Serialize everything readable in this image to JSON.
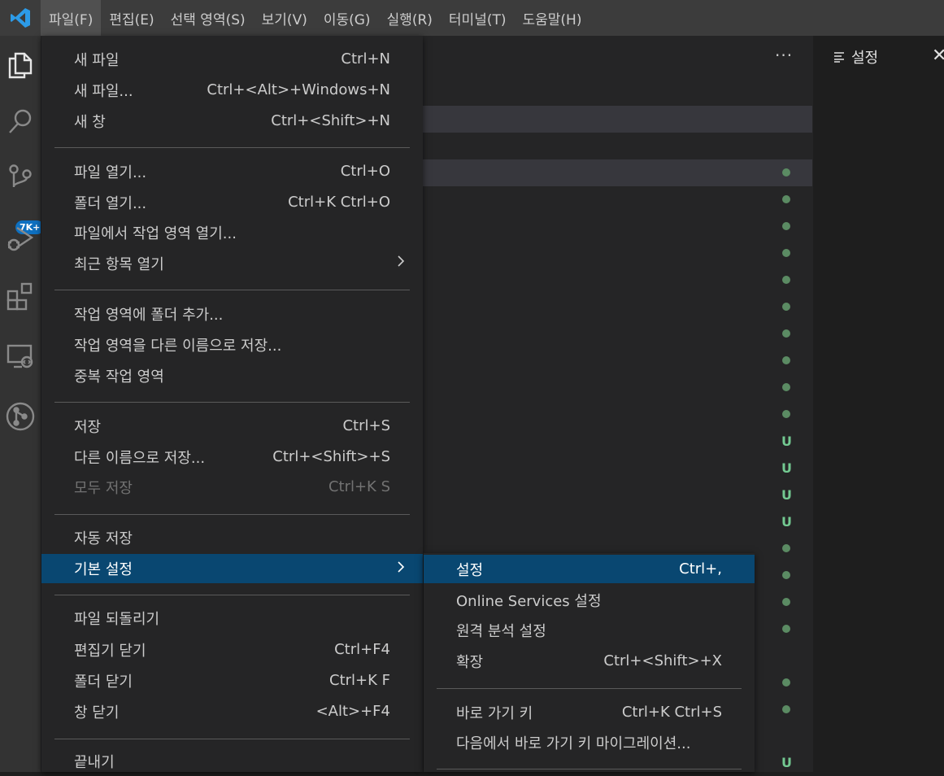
{
  "menubar": {
    "items": [
      "파일(F)",
      "편집(E)",
      "선택 영역(S)",
      "보기(V)",
      "이동(G)",
      "실행(R)",
      "터미널(T)",
      "도움말(H)"
    ]
  },
  "activity": {
    "badge": "7K+"
  },
  "editor": {
    "more_label": "···"
  },
  "right_panel": {
    "title": "설정",
    "close": "✕"
  },
  "status_markers": [
    "•",
    "•",
    "•",
    "•",
    "•",
    "•",
    "•",
    "•",
    "•",
    "•",
    "U",
    "U",
    "U",
    "U",
    "•",
    "•",
    "•",
    "•",
    "•",
    "•",
    "U"
  ],
  "file_menu": {
    "items": [
      {
        "label": "새 파일",
        "key": "Ctrl+N"
      },
      {
        "label": "새 파일...",
        "key": "Ctrl+<Alt>+Windows+N"
      },
      {
        "label": "새 창",
        "key": "Ctrl+<Shift>+N"
      },
      {
        "label": "파일 열기...",
        "key": "Ctrl+O"
      },
      {
        "label": "폴더 열기...",
        "key": "Ctrl+K Ctrl+O"
      },
      {
        "label": "파일에서 작업 영역 열기...",
        "key": ""
      },
      {
        "label": "최근 항목 열기",
        "key": ""
      },
      {
        "label": "작업 영역에 폴더 추가...",
        "key": ""
      },
      {
        "label": "작업 영역을 다른 이름으로 저장...",
        "key": ""
      },
      {
        "label": "중복 작업 영역",
        "key": ""
      },
      {
        "label": "저장",
        "key": "Ctrl+S"
      },
      {
        "label": "다른 이름으로 저장...",
        "key": "Ctrl+<Shift>+S"
      },
      {
        "label": "모두 저장",
        "key": "Ctrl+K S"
      },
      {
        "label": "자동 저장",
        "key": ""
      },
      {
        "label": "기본 설정",
        "key": ""
      },
      {
        "label": "파일 되돌리기",
        "key": ""
      },
      {
        "label": "편집기 닫기",
        "key": "Ctrl+F4"
      },
      {
        "label": "폴더 닫기",
        "key": "Ctrl+K F"
      },
      {
        "label": "창 닫기",
        "key": "<Alt>+F4"
      },
      {
        "label": "끝내기",
        "key": ""
      }
    ]
  },
  "pref_menu": {
    "items": [
      {
        "label": "설정",
        "key": "Ctrl+,"
      },
      {
        "label": "Online Services 설정",
        "key": ""
      },
      {
        "label": "원격 분석 설정",
        "key": ""
      },
      {
        "label": "확장",
        "key": "Ctrl+<Shift>+X"
      },
      {
        "label": "바로 가기 키",
        "key": "Ctrl+K Ctrl+S"
      },
      {
        "label": "다음에서 바로 가기 키 마이그레이션...",
        "key": ""
      }
    ]
  },
  "colors": {
    "selection": "#094771",
    "menu_bg": "#252526",
    "accent_badge": "#0e70c0",
    "untracked": "#73c991"
  }
}
